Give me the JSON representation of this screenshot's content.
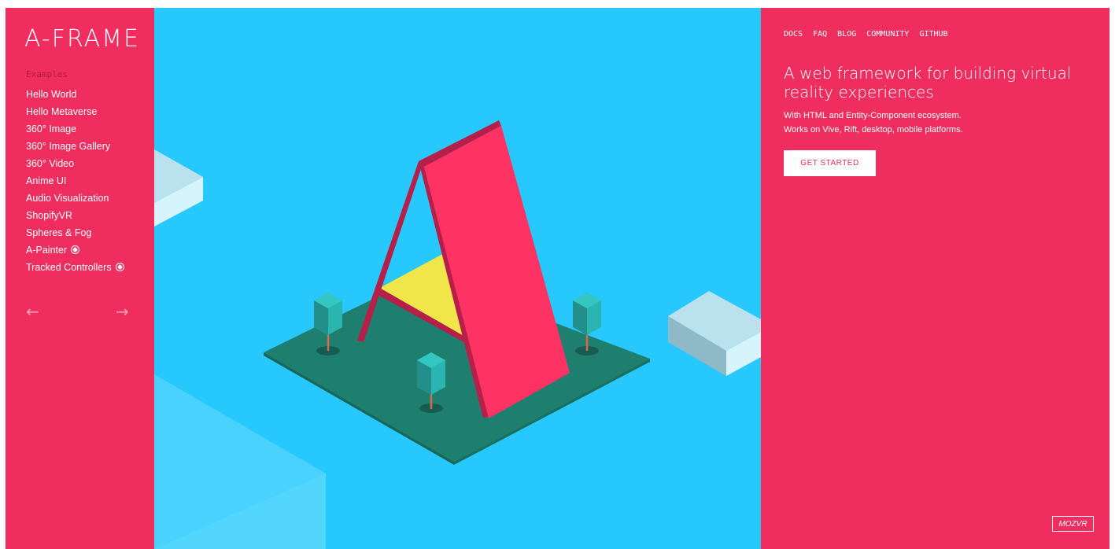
{
  "sidebar": {
    "logo": "A-FRAME",
    "examples_heading": "Examples",
    "examples": [
      {
        "label": "Hello World",
        "vr": false
      },
      {
        "label": "Hello Metaverse",
        "vr": false
      },
      {
        "label": "360° Image",
        "vr": false
      },
      {
        "label": "360° Image Gallery",
        "vr": false
      },
      {
        "label": "360° Video",
        "vr": false
      },
      {
        "label": "Anime UI",
        "vr": false
      },
      {
        "label": "Audio Visualization",
        "vr": false
      },
      {
        "label": "ShopifyVR",
        "vr": false
      },
      {
        "label": "Spheres & Fog",
        "vr": false
      },
      {
        "label": "A-Painter",
        "vr": true
      },
      {
        "label": "Tracked Controllers",
        "vr": true
      }
    ],
    "prev_arrow": "←",
    "next_arrow": "→"
  },
  "nav": {
    "links": [
      "DOCS",
      "FAQ",
      "BLOG",
      "COMMUNITY",
      "GITHUB"
    ]
  },
  "hero": {
    "headline": "A web framework for building virtual reality experiences",
    "sub1": "With HTML and Entity-Component ecosystem.",
    "sub2": "Works on Vive, Rift, desktop, mobile platforms.",
    "cta": "GET STARTED"
  },
  "footer": {
    "badge": "MOZVR"
  },
  "colors": {
    "brand_pink": "#ef2d5e",
    "sky_blue": "#27c8fd",
    "ground_green": "#1f7f6e",
    "tree_teal": "#2ab5b0",
    "triangle_yellow": "#f0e64a"
  },
  "icons": {
    "vr_badge": "vr-headset-icon"
  }
}
